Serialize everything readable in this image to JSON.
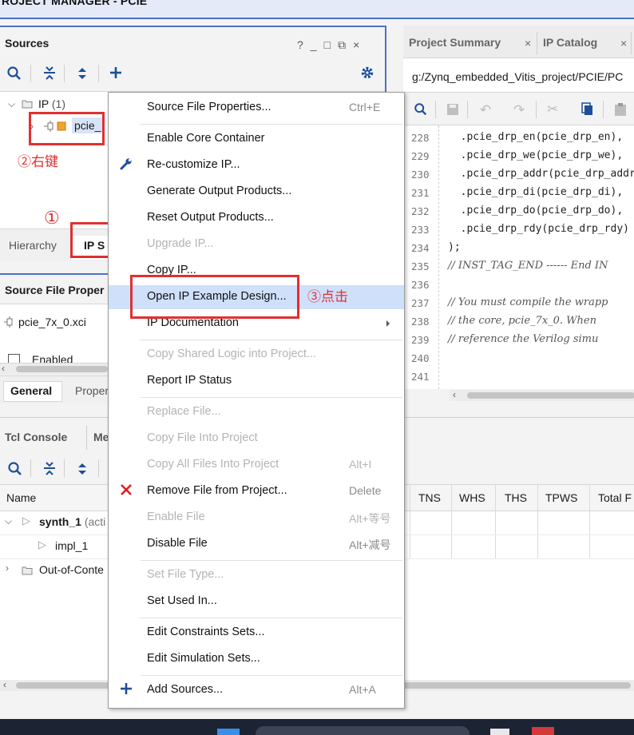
{
  "window": {
    "title": "ROJECT MANAGER - PCIE"
  },
  "sources": {
    "title": "Sources",
    "header_buttons": [
      "?",
      "_",
      "□",
      "⧉",
      "×"
    ],
    "tree": {
      "ip_group": "IP",
      "ip_count": "(1)",
      "ip_item": "pcie_"
    },
    "tabs": [
      "Hierarchy",
      "IP S"
    ]
  },
  "sfp": {
    "title": "Source File Proper",
    "file": "pcie_7x_0.xci",
    "enabled": "Enabled",
    "tabs": [
      "General",
      "Proper"
    ]
  },
  "tcl": {
    "tabs": [
      "Tcl Console",
      "Me"
    ]
  },
  "runs": {
    "headers": [
      "Name",
      "TNS",
      "WHS",
      "THS",
      "TPWS",
      "Total F"
    ],
    "rows": [
      {
        "name": "synth_1",
        "extra": "(acti"
      },
      {
        "name": "impl_1"
      },
      {
        "name": "Out-of-Conte"
      }
    ]
  },
  "editor": {
    "tabs": [
      {
        "label": "Project Summary"
      },
      {
        "label": "IP Catalog"
      }
    ],
    "path": "g:/Zynq_embedded_Vitis_project/PCIE/PC",
    "lines": [
      {
        "n": "228",
        "t": "  .pcie_drp_en(pcie_drp_en),",
        "c": false
      },
      {
        "n": "229",
        "t": "  .pcie_drp_we(pcie_drp_we),",
        "c": false
      },
      {
        "n": "230",
        "t": "  .pcie_drp_addr(pcie_drp_addr",
        "c": false
      },
      {
        "n": "231",
        "t": "  .pcie_drp_di(pcie_drp_di),",
        "c": false
      },
      {
        "n": "232",
        "t": "  .pcie_drp_do(pcie_drp_do),",
        "c": false
      },
      {
        "n": "233",
        "t": "  .pcie_drp_rdy(pcie_drp_rdy)",
        "c": false
      },
      {
        "n": "234",
        "t": ");",
        "c": false
      },
      {
        "n": "235",
        "t": "// INST_TAG_END ------ End IN",
        "c": true
      },
      {
        "n": "236",
        "t": "",
        "c": false
      },
      {
        "n": "237",
        "t": "// You must compile the wrapp",
        "c": true
      },
      {
        "n": "238",
        "t": "// the core, pcie_7x_0. When",
        "c": true
      },
      {
        "n": "239",
        "t": "// reference the Verilog simu",
        "c": true
      },
      {
        "n": "240",
        "t": "",
        "c": false
      },
      {
        "n": "241",
        "t": "",
        "c": false
      }
    ]
  },
  "annotations": {
    "a1": "①",
    "a2": "②右键",
    "a3": "③点击"
  },
  "menu": [
    {
      "label": "Source File Properties...",
      "shortcut": "Ctrl+E",
      "disabled": false
    },
    {
      "label": "Enable Core Container",
      "shortcut": "",
      "disabled": false
    },
    {
      "label": "Re-customize IP...",
      "shortcut": "",
      "disabled": false,
      "icon": "wrench-icon"
    },
    {
      "label": "Generate Output Products...",
      "shortcut": "",
      "disabled": false
    },
    {
      "label": "Reset Output Products...",
      "shortcut": "",
      "disabled": false
    },
    {
      "label": "Upgrade IP...",
      "shortcut": "",
      "disabled": true
    },
    {
      "label": "Copy IP...",
      "shortcut": "",
      "disabled": false
    },
    {
      "label": "Open IP Example Design...",
      "shortcut": "",
      "disabled": false,
      "highlighted": true
    },
    {
      "label": "IP Documentation",
      "shortcut": "",
      "disabled": false,
      "submenu": true
    },
    {
      "label": "Copy Shared Logic into Project...",
      "shortcut": "",
      "disabled": true
    },
    {
      "label": "Report IP Status",
      "shortcut": "",
      "disabled": false
    },
    {
      "label": "Replace File...",
      "shortcut": "",
      "disabled": true
    },
    {
      "label": "Copy File Into Project",
      "shortcut": "",
      "disabled": true
    },
    {
      "label": "Copy All Files Into Project",
      "shortcut": "Alt+I",
      "disabled": true
    },
    {
      "label": "Remove File from Project...",
      "shortcut": "Delete",
      "disabled": false,
      "icon": "remove-icon"
    },
    {
      "label": "Enable File",
      "shortcut": "Alt+等号",
      "disabled": true
    },
    {
      "label": "Disable File",
      "shortcut": "Alt+减号",
      "disabled": false
    },
    {
      "label": "Set File Type...",
      "shortcut": "",
      "disabled": true
    },
    {
      "label": "Set Used In...",
      "shortcut": "",
      "disabled": false
    },
    {
      "label": "Edit Constraints Sets...",
      "shortcut": "",
      "disabled": false
    },
    {
      "label": "Edit Simulation Sets...",
      "shortcut": "",
      "disabled": false
    },
    {
      "label": "Add Sources...",
      "shortcut": "Alt+A",
      "disabled": false,
      "icon": "add-icon"
    }
  ],
  "colors": {
    "accent": "#2d5fa8",
    "highlight": "#cfe0fb",
    "annotation": "#e03030",
    "selection": "#d7e3f7"
  }
}
